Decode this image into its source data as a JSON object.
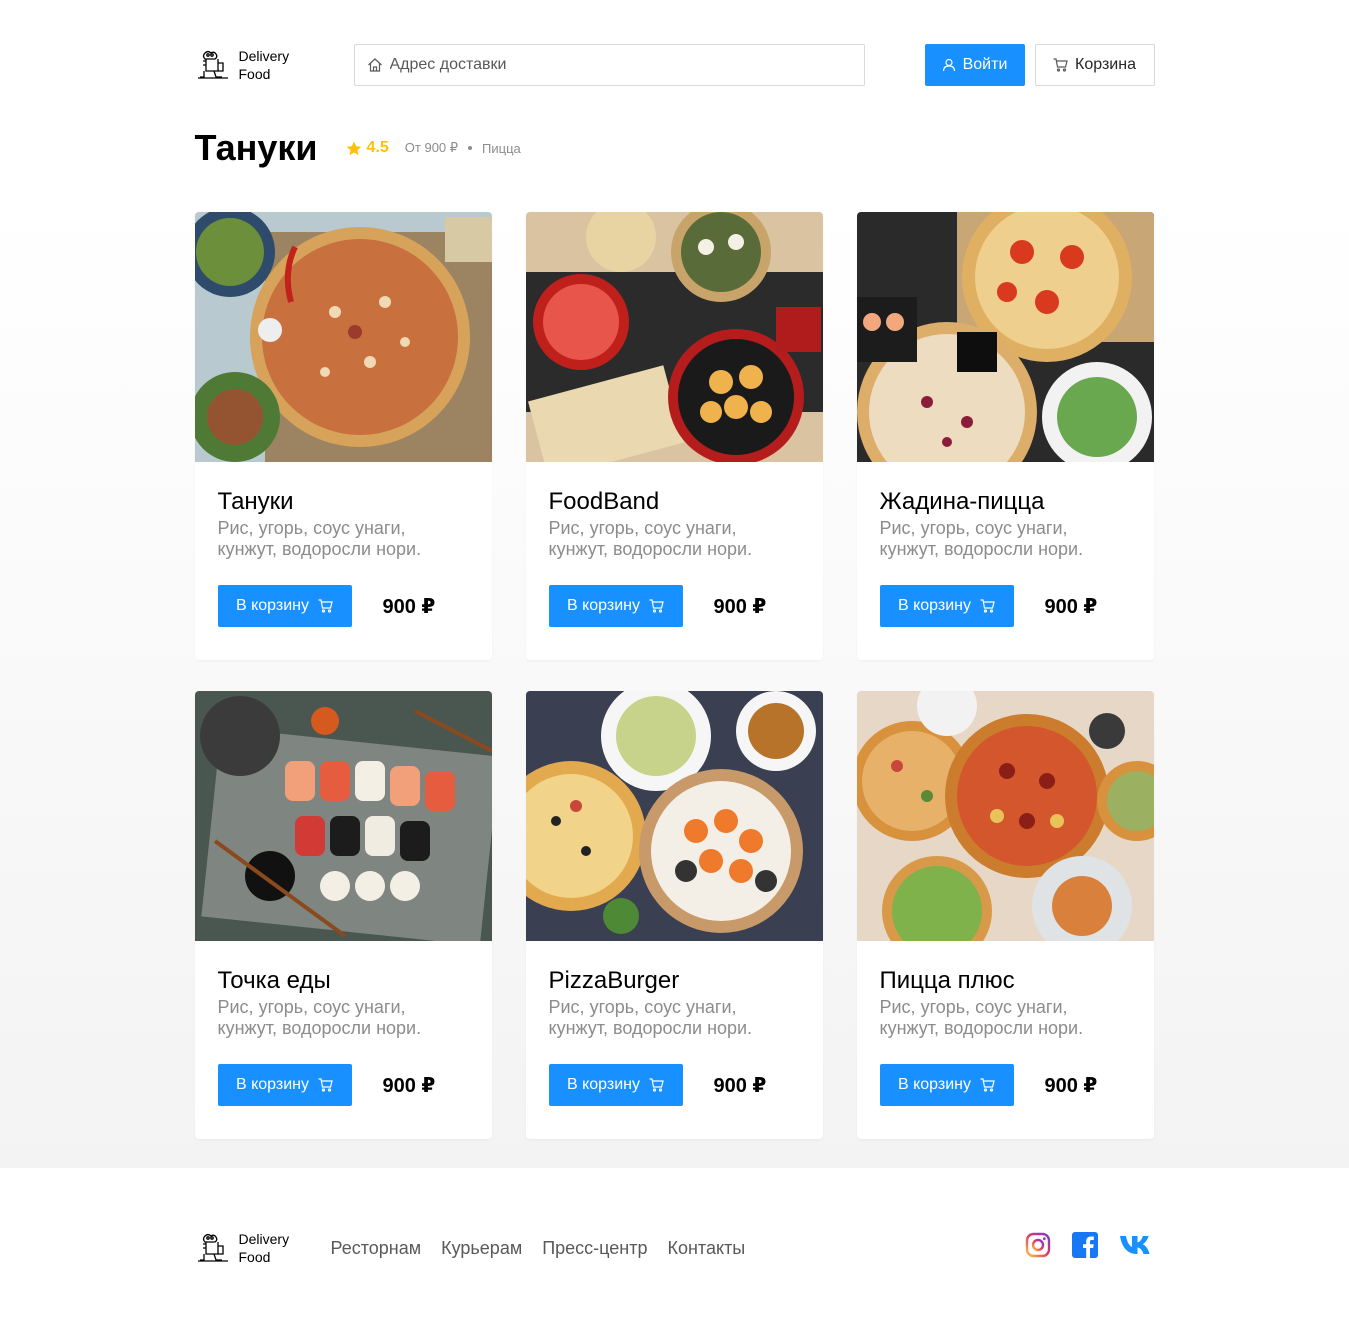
{
  "header": {
    "logo_line1": "Delivery",
    "logo_line2": "Food",
    "address_placeholder": "Адрес доставки",
    "login_label": "Войти",
    "cart_label": "Корзина"
  },
  "restaurant": {
    "title": "Тануки",
    "rating": "4.5",
    "price_from": "От 900 ₽",
    "category": "Пицца"
  },
  "cards": [
    {
      "title": "Тануки",
      "desc": "Рис, угорь, соус унаги, кунжут, водоросли нори.",
      "button": "В корзину",
      "price": "900 ₽",
      "image": "pizza-table-photo"
    },
    {
      "title": "FoodBand",
      "desc": "Рис, угорь, соус унаги, кунжут, водоросли нори.",
      "button": "В корзину",
      "price": "900 ₽",
      "image": "dim-sum-photo"
    },
    {
      "title": "Жадина-пицца",
      "desc": "Рис, угорь, соус унаги, кунжут, водоросли нори.",
      "button": "В корзину",
      "price": "900 ₽",
      "image": "pizza-sushi-photo"
    },
    {
      "title": "Точка еды",
      "desc": "Рис, угорь, соус унаги, кунжут, водоросли нори.",
      "button": "В корзину",
      "price": "900 ₽",
      "image": "sushi-set-photo"
    },
    {
      "title": "PizzaBurger",
      "desc": "Рис, угорь, соус унаги, кунжут, водоросли нори.",
      "button": "В корзину",
      "price": "900 ₽",
      "image": "pizza-rolls-photo"
    },
    {
      "title": "Пицца плюс",
      "desc": "Рис, угорь, соус унаги, кунжут, водоросли нори.",
      "button": "В корзину",
      "price": "900 ₽",
      "image": "pizzas-photo"
    }
  ],
  "footer": {
    "logo_line1": "Delivery",
    "logo_line2": "Food",
    "links": [
      "Ресторнам",
      "Курьерам",
      "Пресс-центр",
      "Контакты"
    ],
    "socials": [
      "instagram-icon",
      "facebook-icon",
      "vk-icon"
    ]
  },
  "colors": {
    "accent": "#1890ff",
    "rating": "#ffc107",
    "muted": "#8c8c8c",
    "vk": "#1890ff",
    "facebook": "#1877f2"
  }
}
